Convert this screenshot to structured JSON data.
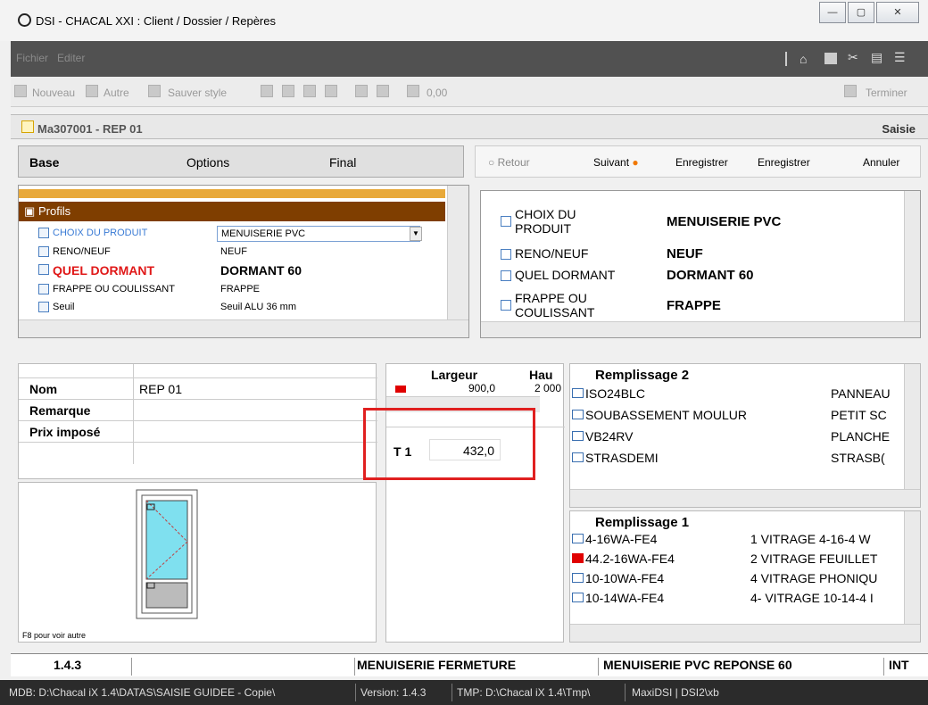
{
  "window": {
    "title": "DSI - CHACAL XXI : Client / Dossier / Repères",
    "btn_min": "—",
    "btn_max": "▢",
    "btn_close": "✕"
  },
  "menu": {
    "items": [
      "Fichier",
      "Editer"
    ]
  },
  "toolbar": {
    "nouveau": "Nouveau",
    "autre": "Autre",
    "sauver_style": "Sauver style",
    "value": "0,00",
    "terminer": "Terminer"
  },
  "header": {
    "name": "Ma307001 - REP 01",
    "saisie": "Saisie"
  },
  "tabs": {
    "base": "Base",
    "options": "Options",
    "final": "Final"
  },
  "actions": {
    "retour": "Retour",
    "suivant": "Suivant",
    "enregistrer": "Enregistrer",
    "enregistrer2": "Enregistrer",
    "annuler": "Annuler"
  },
  "profils": {
    "heading": "Profils",
    "rows": [
      {
        "label": "CHOIX DU PRODUIT",
        "value": "MENUISERIE PVC"
      },
      {
        "label": "RENO/NEUF",
        "value": "NEUF"
      },
      {
        "label": "QUEL DORMANT",
        "value": "DORMANT 60"
      },
      {
        "label": "FRAPPE OU COULISSANT",
        "value": "FRAPPE"
      },
      {
        "label": "Seuil",
        "value": "Seuil ALU 36 mm"
      }
    ]
  },
  "choices": [
    {
      "label1": "CHOIX DU",
      "label2": "PRODUIT",
      "value": "MENUISERIE PVC"
    },
    {
      "label1": "RENO/NEUF",
      "label2": "",
      "value": "NEUF"
    },
    {
      "label1": "QUEL DORMANT",
      "label2": "",
      "value": "DORMANT 60"
    },
    {
      "label1": "FRAPPE OU",
      "label2": "COULISSANT",
      "value": "FRAPPE"
    }
  ],
  "info": {
    "nom_label": "Nom",
    "nom_value": "REP 01",
    "remarque_label": "Remarque",
    "prix_label": "Prix imposé"
  },
  "preview": {
    "caption": "F8 pour voir autre"
  },
  "dims": {
    "largeur": "Largeur",
    "hau": "Hau",
    "w": "900,0",
    "h": "2 000",
    "t1_label": "T 1",
    "t1_value": "432,0"
  },
  "remplissage2": {
    "title": "Remplissage 2",
    "items": [
      {
        "code": "ISO24BLC",
        "desc": "PANNEAU"
      },
      {
        "code": "SOUBASSEMENT MOULUR",
        "desc": "PETIT SC"
      },
      {
        "code": "VB24RV",
        "desc": "PLANCHE"
      },
      {
        "code": "STRASDEMI",
        "desc": "STRASB("
      }
    ]
  },
  "remplissage1": {
    "title": "Remplissage 1",
    "items": [
      {
        "code": "4-16WA-FE4",
        "desc": "1 VITRAGE  4-16-4 W"
      },
      {
        "code": "44.2-16WA-FE4",
        "desc": "2 VITRAGE FEUILLET"
      },
      {
        "code": "10-10WA-FE4",
        "desc": "4 VITRAGE PHONIQU"
      },
      {
        "code": "10-14WA-FE4",
        "desc": "4- VITRAGE 10-14-4 I"
      }
    ]
  },
  "bottom": {
    "version": "1.4.3",
    "menuiserie": "MENUISERIE FERMETURE",
    "reponse": "MENUISERIE PVC REPONSE 60",
    "int": "INT"
  },
  "status": {
    "mdb": "MDB: D:\\Chacal iX 1.4\\DATAS\\SAISIE GUIDEE - Copie\\",
    "version": "Version: 1.4.3",
    "tmp": "TMP: D:\\Chacal iX 1.4\\Tmp\\",
    "maxi": "MaxiDSI | DSI2\\xb"
  }
}
